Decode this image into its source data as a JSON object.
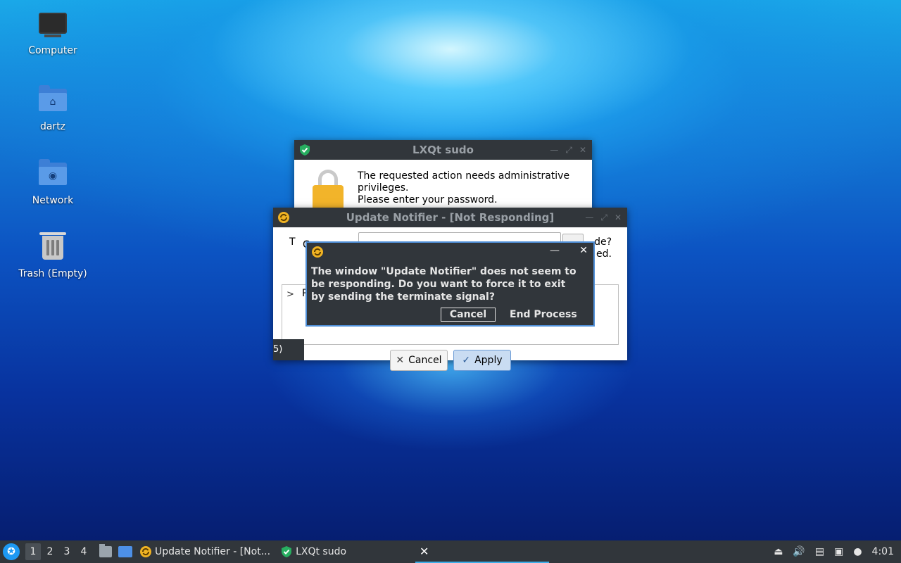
{
  "desktop": {
    "icons": [
      {
        "label": "Computer"
      },
      {
        "label": "dartz"
      },
      {
        "label": "Network"
      },
      {
        "label": "Trash (Empty)"
      }
    ]
  },
  "sudo_window": {
    "title": "LXQt sudo",
    "message_line1": "The requested action needs administrative",
    "message_line2": "privileges.",
    "message_line3": "Please enter your password."
  },
  "update_window": {
    "title": "Update Notifier - [Not Responding]",
    "frag_t": "T",
    "frag_c": "C",
    "frag_right_line1": "de?",
    "frag_right_line2": "ed.",
    "frag_p": "P",
    "status_text": "5)",
    "cancel_label": "Cancel",
    "apply_label": "Apply"
  },
  "confirm_dialog": {
    "message_line1": "The window \"Update Notifier\" does not seem to",
    "message_line2": "be responding.  Do you want to force it to exit",
    "message_line3": "by sending the terminate signal?",
    "cancel_label": "Cancel",
    "end_process_label": "End Process"
  },
  "taskbar": {
    "workspaces": [
      "1",
      "2",
      "3",
      "4"
    ],
    "active_workspace": "1",
    "tasks": [
      {
        "label": "Update Notifier - [Not..."
      },
      {
        "label": "LXQt sudo"
      }
    ],
    "clock": "4:01"
  },
  "colors": {
    "titlebar_bg": "#31363b",
    "focus_border": "#4f8fd8",
    "apply_bg": "#c9dcf2",
    "accent": "#3daee9"
  }
}
